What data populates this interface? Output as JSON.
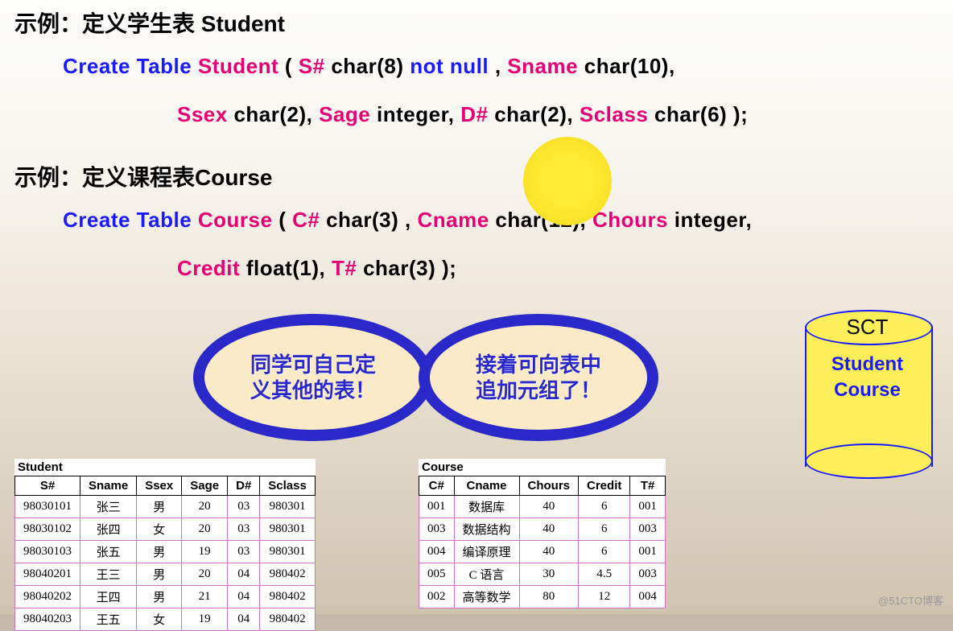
{
  "heading1": "示例：定义学生表 Student",
  "sql1_parts": [
    {
      "t": "Create",
      "c": "kw-blue"
    },
    {
      "t": "  ",
      "c": ""
    },
    {
      "t": "Table",
      "c": "kw-blue"
    },
    {
      "t": "  ",
      "c": ""
    },
    {
      "t": "Student",
      "c": "kw-red"
    },
    {
      "t": " ( ",
      "c": "kw-black"
    },
    {
      "t": "S#",
      "c": "kw-red"
    },
    {
      "t": "  ",
      "c": ""
    },
    {
      "t": "char(8)",
      "c": "kw-black"
    },
    {
      "t": "  ",
      "c": ""
    },
    {
      "t": "not null",
      "c": "kw-blue"
    },
    {
      "t": " , ",
      "c": "kw-black"
    },
    {
      "t": "Sname",
      "c": "kw-red"
    },
    {
      "t": "  ",
      "c": ""
    },
    {
      "t": "char(10),",
      "c": "kw-black"
    }
  ],
  "sql1b_parts": [
    {
      "t": "Ssex",
      "c": "kw-red"
    },
    {
      "t": "  ",
      "c": ""
    },
    {
      "t": "char(2),",
      "c": "kw-black"
    },
    {
      "t": "  ",
      "c": ""
    },
    {
      "t": "Sage",
      "c": "kw-red"
    },
    {
      "t": "  ",
      "c": ""
    },
    {
      "t": "integer,",
      "c": "kw-black"
    },
    {
      "t": "  ",
      "c": ""
    },
    {
      "t": "D#",
      "c": "kw-red"
    },
    {
      "t": "  ",
      "c": ""
    },
    {
      "t": "char(2),",
      "c": "kw-black"
    },
    {
      "t": "  ",
      "c": ""
    },
    {
      "t": "Sclass",
      "c": "kw-red"
    },
    {
      "t": "  ",
      "c": ""
    },
    {
      "t": "char(6) );",
      "c": "kw-black"
    }
  ],
  "heading2": "示例：定义课程表Course",
  "sql2_parts": [
    {
      "t": "Create",
      "c": "kw-blue"
    },
    {
      "t": "  ",
      "c": ""
    },
    {
      "t": "Table",
      "c": "kw-blue"
    },
    {
      "t": " ",
      "c": ""
    },
    {
      "t": "Course",
      "c": "kw-red"
    },
    {
      "t": " ( ",
      "c": "kw-black"
    },
    {
      "t": "C#",
      "c": "kw-red"
    },
    {
      "t": "  ",
      "c": ""
    },
    {
      "t": "char(3) ,",
      "c": "kw-black"
    },
    {
      "t": "  ",
      "c": ""
    },
    {
      "t": "Cname",
      "c": "kw-red"
    },
    {
      "t": "  ",
      "c": ""
    },
    {
      "t": "char(12),",
      "c": "kw-black"
    },
    {
      "t": " ",
      "c": ""
    },
    {
      "t": "Chours",
      "c": "kw-red"
    },
    {
      "t": "   ",
      "c": ""
    },
    {
      "t": "integer,",
      "c": "kw-black"
    }
  ],
  "sql2b_parts": [
    {
      "t": "Credit",
      "c": "kw-red"
    },
    {
      "t": "  ",
      "c": ""
    },
    {
      "t": "float(1),",
      "c": "kw-black"
    },
    {
      "t": "  ",
      "c": ""
    },
    {
      "t": "T#",
      "c": "kw-red"
    },
    {
      "t": "  ",
      "c": ""
    },
    {
      "t": "char(3) );",
      "c": "kw-black"
    }
  ],
  "oval1_line1": "同学可自己定",
  "oval1_line2": "义其他的表！",
  "oval2_line1": "接着可向表中",
  "oval2_line2": "追加元组了！",
  "cyl_title": "SCT",
  "cyl_line1": "Student",
  "cyl_line2": "Course",
  "student_label": "Student",
  "student_headers": [
    "S#",
    "Sname",
    "Ssex",
    "Sage",
    "D#",
    "Sclass"
  ],
  "student_rows": [
    [
      "98030101",
      "张三",
      "男",
      "20",
      "03",
      "980301"
    ],
    [
      "98030102",
      "张四",
      "女",
      "20",
      "03",
      "980301"
    ],
    [
      "98030103",
      "张五",
      "男",
      "19",
      "03",
      "980301"
    ],
    [
      "98040201",
      "王三",
      "男",
      "20",
      "04",
      "980402"
    ],
    [
      "98040202",
      "王四",
      "男",
      "21",
      "04",
      "980402"
    ],
    [
      "98040203",
      "王五",
      "女",
      "19",
      "04",
      "980402"
    ]
  ],
  "course_label": "Course",
  "course_headers": [
    "C#",
    "Cname",
    "Chours",
    "Credit",
    "T#"
  ],
  "course_rows": [
    [
      "001",
      "数据库",
      "40",
      "6",
      "001"
    ],
    [
      "003",
      "数据结构",
      "40",
      "6",
      "003"
    ],
    [
      "004",
      "编译原理",
      "40",
      "6",
      "001"
    ],
    [
      "005",
      "C 语言",
      "30",
      "4.5",
      "003"
    ],
    [
      "002",
      "高等数学",
      "80",
      "12",
      "004"
    ]
  ],
  "watermark": "@51CTO博客"
}
